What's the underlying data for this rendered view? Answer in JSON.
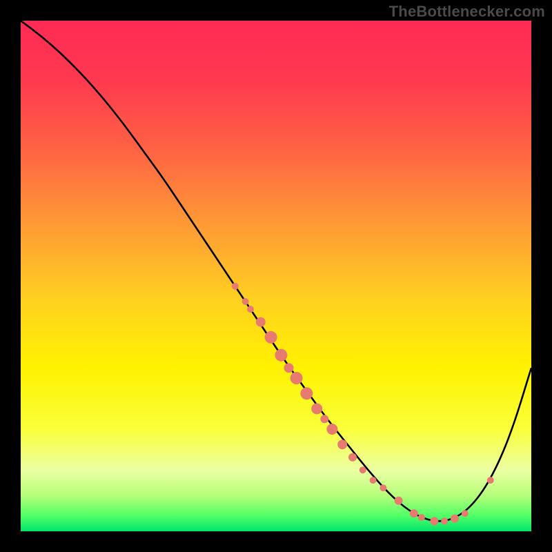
{
  "attribution": "TheBottlenecker.com",
  "colors": {
    "background": "#000000",
    "curve_stroke": "#000000",
    "dot_fill": "#e87b6f",
    "attribution_text": "#4a4a4a"
  },
  "gradient_stops": [
    {
      "offset": 0.0,
      "color": "#ff2a55"
    },
    {
      "offset": 0.12,
      "color": "#ff3a4f"
    },
    {
      "offset": 0.25,
      "color": "#ff6244"
    },
    {
      "offset": 0.4,
      "color": "#ff9a35"
    },
    {
      "offset": 0.55,
      "color": "#ffd21f"
    },
    {
      "offset": 0.68,
      "color": "#fff200"
    },
    {
      "offset": 0.8,
      "color": "#faff3a"
    },
    {
      "offset": 0.88,
      "color": "#ecffa4"
    },
    {
      "offset": 0.93,
      "color": "#b6ff7a"
    },
    {
      "offset": 0.97,
      "color": "#4fff66"
    },
    {
      "offset": 1.0,
      "color": "#00e56a"
    }
  ],
  "chart_data": {
    "type": "line",
    "title": "",
    "xlabel": "",
    "ylabel": "",
    "xlim": [
      0,
      100
    ],
    "ylim": [
      0,
      100
    ],
    "series": [
      {
        "name": "curve",
        "x": [
          0,
          4,
          8,
          12,
          16,
          20,
          24,
          28,
          32,
          36,
          40,
          44,
          48,
          52,
          56,
          60,
          64,
          68,
          72,
          76,
          80,
          84,
          88,
          92,
          96,
          100
        ],
        "y": [
          100,
          97,
          93.5,
          89.5,
          85,
          80,
          74.5,
          69,
          63,
          57,
          51,
          45,
          39,
          33,
          27.5,
          22,
          17,
          12,
          7.5,
          4,
          2,
          2,
          4.5,
          10,
          19,
          32
        ]
      }
    ],
    "scatter": {
      "name": "dots",
      "points": [
        {
          "x": 42,
          "y": 48,
          "r": 5
        },
        {
          "x": 44,
          "y": 45,
          "r": 5
        },
        {
          "x": 45,
          "y": 43.5,
          "r": 5
        },
        {
          "x": 47,
          "y": 41,
          "r": 7
        },
        {
          "x": 49,
          "y": 38,
          "r": 9
        },
        {
          "x": 51,
          "y": 34.5,
          "r": 9
        },
        {
          "x": 52.5,
          "y": 32,
          "r": 7
        },
        {
          "x": 54,
          "y": 30,
          "r": 9
        },
        {
          "x": 56,
          "y": 27,
          "r": 9
        },
        {
          "x": 58,
          "y": 24,
          "r": 8
        },
        {
          "x": 59.5,
          "y": 22,
          "r": 6
        },
        {
          "x": 61,
          "y": 20,
          "r": 8
        },
        {
          "x": 63,
          "y": 17,
          "r": 7
        },
        {
          "x": 65,
          "y": 14.5,
          "r": 6
        },
        {
          "x": 67,
          "y": 12,
          "r": 5
        },
        {
          "x": 69,
          "y": 10,
          "r": 5
        },
        {
          "x": 71,
          "y": 8.5,
          "r": 5
        },
        {
          "x": 74,
          "y": 6,
          "r": 6
        },
        {
          "x": 77,
          "y": 3.5,
          "r": 6
        },
        {
          "x": 78.5,
          "y": 2.7,
          "r": 5
        },
        {
          "x": 81,
          "y": 2,
          "r": 6
        },
        {
          "x": 83,
          "y": 2,
          "r": 5
        },
        {
          "x": 85,
          "y": 2.5,
          "r": 6
        },
        {
          "x": 87,
          "y": 3.5,
          "r": 5
        },
        {
          "x": 92,
          "y": 10,
          "r": 5
        }
      ]
    }
  }
}
